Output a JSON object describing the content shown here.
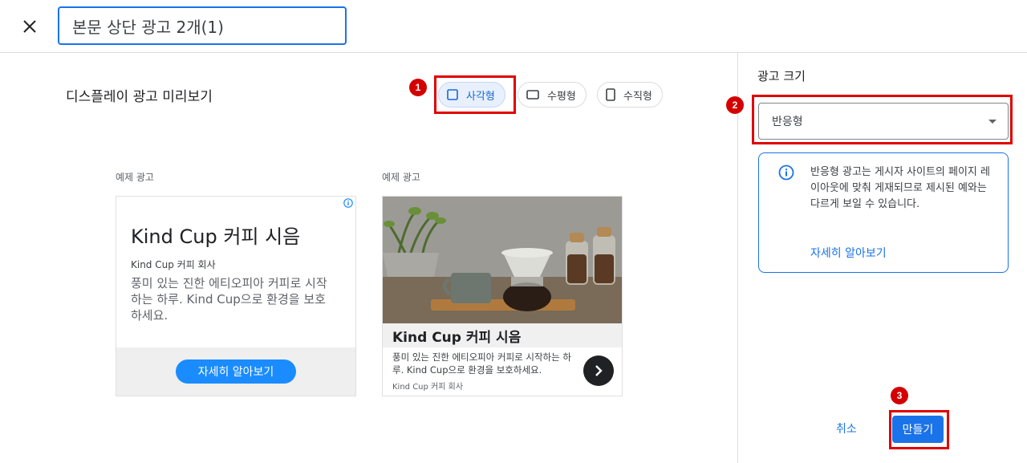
{
  "header": {
    "title_value": "본문 상단 광고 2개(1)",
    "close_icon": "close-icon"
  },
  "preview": {
    "title": "디스플레이 광고 미리보기",
    "tabs": [
      {
        "label": "사각형",
        "icon": "square-icon",
        "selected": true
      },
      {
        "label": "수평형",
        "icon": "landscape-icon",
        "selected": false
      },
      {
        "label": "수직형",
        "icon": "portrait-icon",
        "selected": false
      }
    ],
    "example_label": "예제 광고",
    "ad1": {
      "headline": "Kind Cup 커피 시음",
      "company": "Kind Cup 커피 회사",
      "description": "풍미 있는 진한 에티오피아 커피로 시작하는 하루. Kind Cup으로 환경을 보호하세요.",
      "cta": "자세히 알아보기"
    },
    "ad2": {
      "headline": "Kind Cup 커피 시음",
      "description": "풍미 있는 진한 에티오피아 커피로 시작하는 하루. Kind Cup으로 환경을 보호하세요.",
      "company": "Kind Cup 커피 회사"
    }
  },
  "sidebar": {
    "size_label": "광고 크기",
    "size_value": "반응형",
    "info_text": "반응형 광고는 게시자 사이트의 페이지 레이아웃에 맞춰 게재되므로 제시된 예와는 다르게 보일 수 있습니다.",
    "learn_more": "자세히 알아보기",
    "cancel_label": "취소",
    "create_label": "만들기"
  },
  "annotations": {
    "badge1": "1",
    "badge2": "2",
    "badge3": "3"
  },
  "colors": {
    "accent": "#1a73e8",
    "annotation_red": "#e00000",
    "cta_blue": "#1a8cff"
  }
}
